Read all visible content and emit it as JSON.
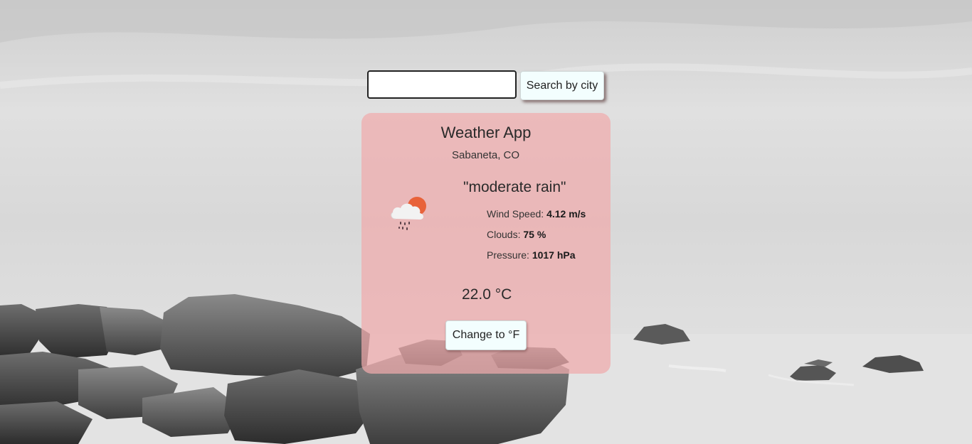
{
  "search": {
    "input_value": "",
    "placeholder": "",
    "button_label": "Search by city"
  },
  "card": {
    "title": "Weather App",
    "location": "Sabaneta, CO",
    "description": "\"moderate rain\"",
    "icon": "rain-cloud-sun-icon",
    "stats": {
      "wind_label": "Wind Speed: ",
      "wind_value": "4.12 m/s",
      "clouds_label": "Clouds: ",
      "clouds_value": "75 %",
      "pressure_label": "Pressure: ",
      "pressure_value": "1017 hPa"
    },
    "temperature": "22.0 °C",
    "toggle_label": "Change to °F"
  },
  "colors": {
    "card_background": "#f0aaac",
    "button_background": "#f3fefe",
    "sun": "#e8623a"
  }
}
